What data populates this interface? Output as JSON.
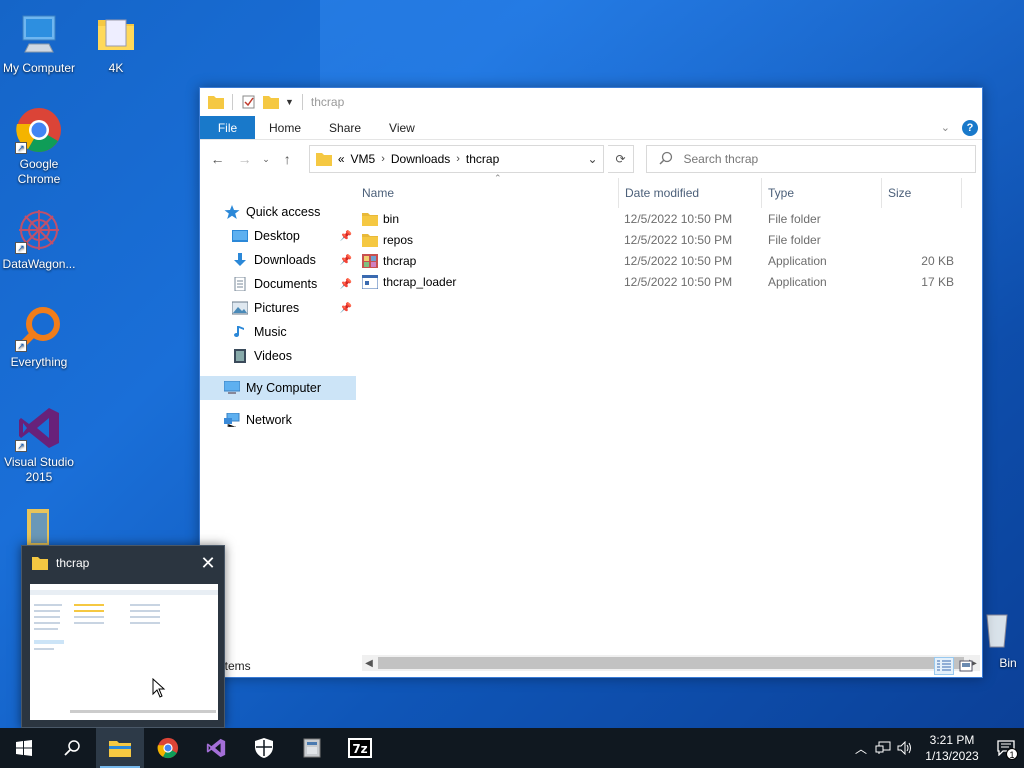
{
  "desktop": {
    "icons": [
      {
        "label": "My Computer"
      },
      {
        "label": "4K"
      },
      {
        "label": "Google Chrome"
      },
      {
        "label": "DataWagon..."
      },
      {
        "label": "Everything"
      },
      {
        "label": "Visual Studio 2015"
      },
      {
        "label": "Bin"
      }
    ]
  },
  "window": {
    "title": "thcrap",
    "ribbon_tabs": [
      "File",
      "Home",
      "Share",
      "View"
    ],
    "address": {
      "overflow": "«",
      "crumbs": [
        "VM5",
        "Downloads",
        "thcrap"
      ]
    },
    "search_placeholder": "Search thcrap",
    "nav": {
      "quick_access": "Quick access",
      "items": [
        "Desktop",
        "Downloads",
        "Documents",
        "Pictures",
        "Music",
        "Videos"
      ],
      "my_computer": "My Computer",
      "network": "Network"
    },
    "columns": {
      "name": "Name",
      "date": "Date modified",
      "type": "Type",
      "size": "Size"
    },
    "files": [
      {
        "name": "bin",
        "date": "12/5/2022 10:50 PM",
        "type": "File folder",
        "size": "",
        "icon": "folder-icon"
      },
      {
        "name": "repos",
        "date": "12/5/2022 10:50 PM",
        "type": "File folder",
        "size": "",
        "icon": "folder-icon"
      },
      {
        "name": "thcrap",
        "date": "12/5/2022 10:50 PM",
        "type": "Application",
        "size": "20 KB",
        "icon": "thcrap-app-icon"
      },
      {
        "name": "thcrap_loader",
        "date": "12/5/2022 10:50 PM",
        "type": "Application",
        "size": "17 KB",
        "icon": "console-app-icon"
      }
    ],
    "status": "items"
  },
  "preview": {
    "title": "thcrap"
  },
  "taskbar": {
    "time": "3:21 PM",
    "date": "1/13/2023",
    "notification_count": "1"
  },
  "colors": {
    "accent": "#1979ca",
    "selection": "#cce4f7",
    "taskbar": "#101820",
    "folder": "#f5c842"
  }
}
